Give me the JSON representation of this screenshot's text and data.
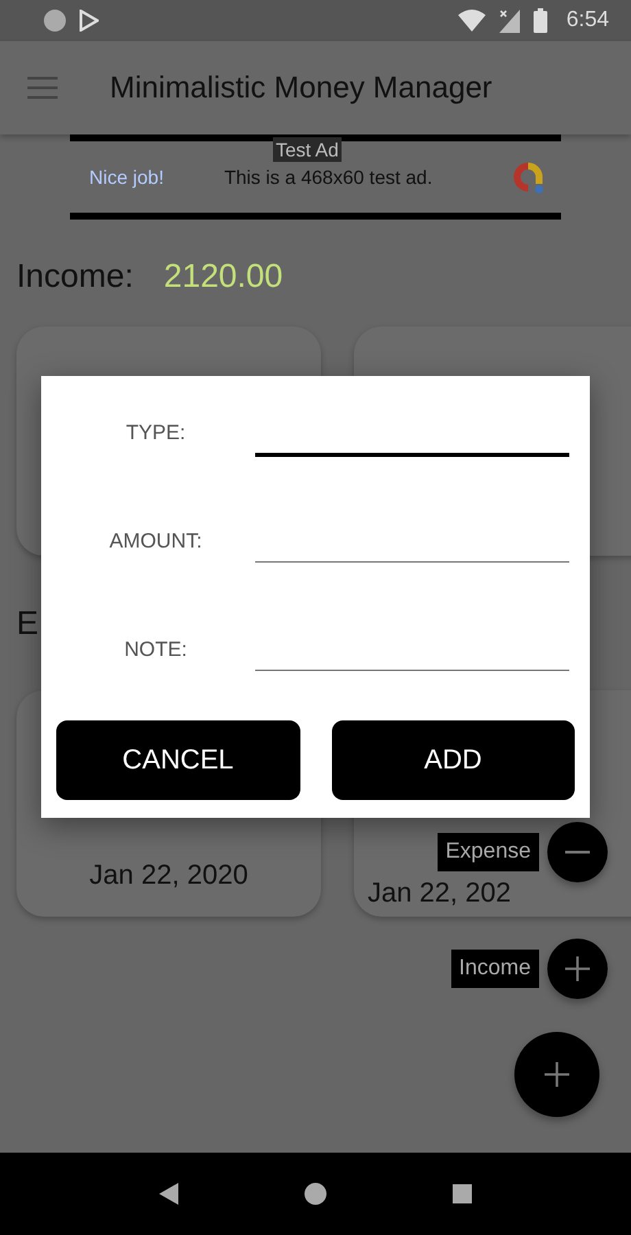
{
  "status_bar": {
    "time": "6:54"
  },
  "app_bar": {
    "title": "Minimalistic Money Manager"
  },
  "ad": {
    "badge": "Test Ad",
    "headline": "Nice job!",
    "text": "This is a 468x60 test ad."
  },
  "income": {
    "label": "Income:",
    "value": "2120.00"
  },
  "expenses": {
    "heading": "E",
    "entries": [
      {
        "date": "Jan 22, 2020"
      },
      {
        "date": "Jan 22, 202"
      }
    ]
  },
  "dialog": {
    "fields": [
      {
        "label": "TYPE:",
        "focused": true
      },
      {
        "label": "AMOUNT:",
        "focused": false
      },
      {
        "label": "NOTE:",
        "focused": false
      }
    ],
    "buttons": [
      {
        "label": "CANCEL"
      },
      {
        "label": "ADD"
      }
    ]
  },
  "fab_menu": [
    {
      "label": "Expense",
      "kind": "minus"
    },
    {
      "label": "Income",
      "kind": "plus"
    }
  ]
}
